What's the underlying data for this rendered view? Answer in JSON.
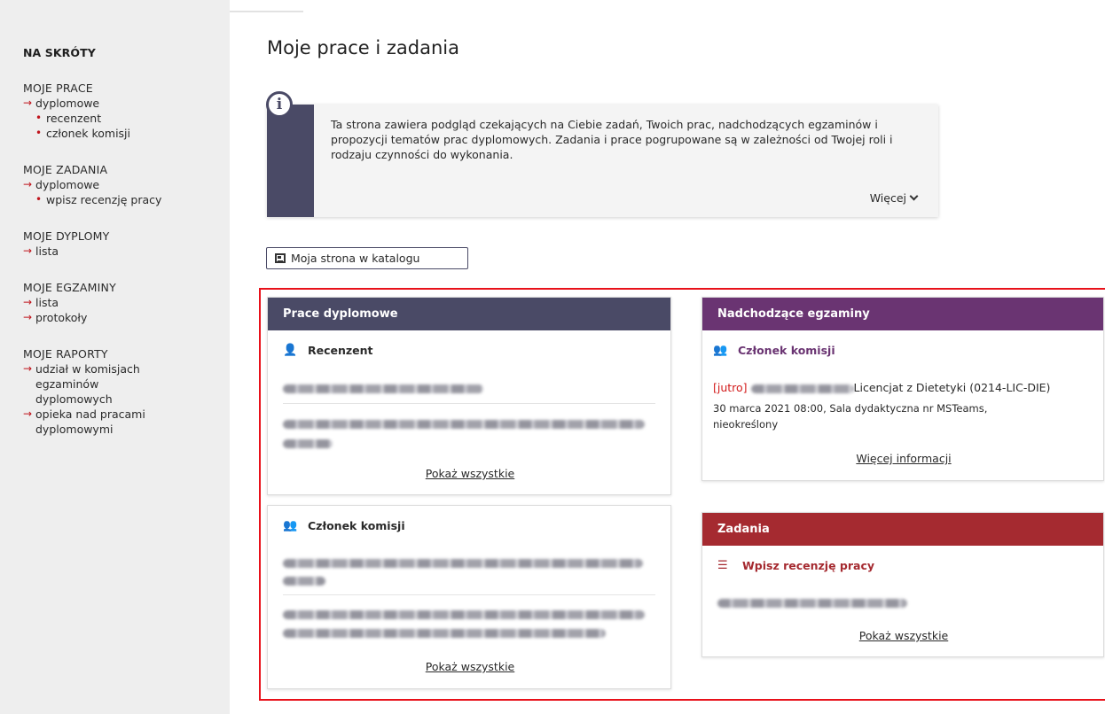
{
  "sidebar": {
    "heading": "NA SKRÓTY",
    "sections": [
      {
        "title": "MOJE PRACE",
        "link": "dyplomowe",
        "subs": [
          "recenzent",
          "członek komisji"
        ]
      },
      {
        "title": "MOJE ZADANIA",
        "link": "dyplomowe",
        "subs": [
          "wpisz recenzję pracy"
        ]
      },
      {
        "title": "MOJE DYPLOMY",
        "link": "lista"
      },
      {
        "title": "MOJE EGZAMINY",
        "links": [
          "lista",
          "protokoły"
        ]
      },
      {
        "title": "MOJE RAPORTY",
        "links": [
          "udział w komisjach egzaminów dyplomowych",
          "opieka nad pracami dyplomowymi"
        ]
      }
    ]
  },
  "main": {
    "title": "Moje prace i zadania",
    "info": {
      "text": "Ta strona zawiera podgląd czekających na Ciebie zadań, Twoich prac, nadchodzących egzaminów i propozycji tematów prac dyplomowych. Zadania i prace pogrupowane są w zależności od Twojej roli i rodzaju czynności do wykonania.",
      "more_label": "Więcej"
    },
    "catalog_button": "Moja strona w katalogu"
  },
  "panels": {
    "theses": {
      "header": "Prace dyplomowe",
      "reviewer_title": "Recenzent",
      "show_all": "Pokaż wszystkie"
    },
    "committee": {
      "title": "Członek komisji",
      "show_all": "Pokaż wszystkie"
    },
    "exams": {
      "header": "Nadchodzące egzaminy",
      "role_title": "Członek komisji",
      "tomorrow": "[jutro]",
      "degree": "Licencjat z Dietetyki (0214-LIC-DIE)",
      "details": "30 marca 2021 08:00, Sala dydaktyczna nr MSTeams,",
      "details2": "nieokreślony",
      "more_info": "Więcej informacji"
    },
    "tasks": {
      "header": "Zadania",
      "task_title": "Wpisz recenzję pracy",
      "show_all": "Pokaż wszystkie"
    }
  },
  "colors": {
    "accent_dark": "#4a4a66",
    "accent_purple": "#6a3472",
    "accent_red": "#a52a30",
    "highlight_frame": "#e8111a"
  }
}
